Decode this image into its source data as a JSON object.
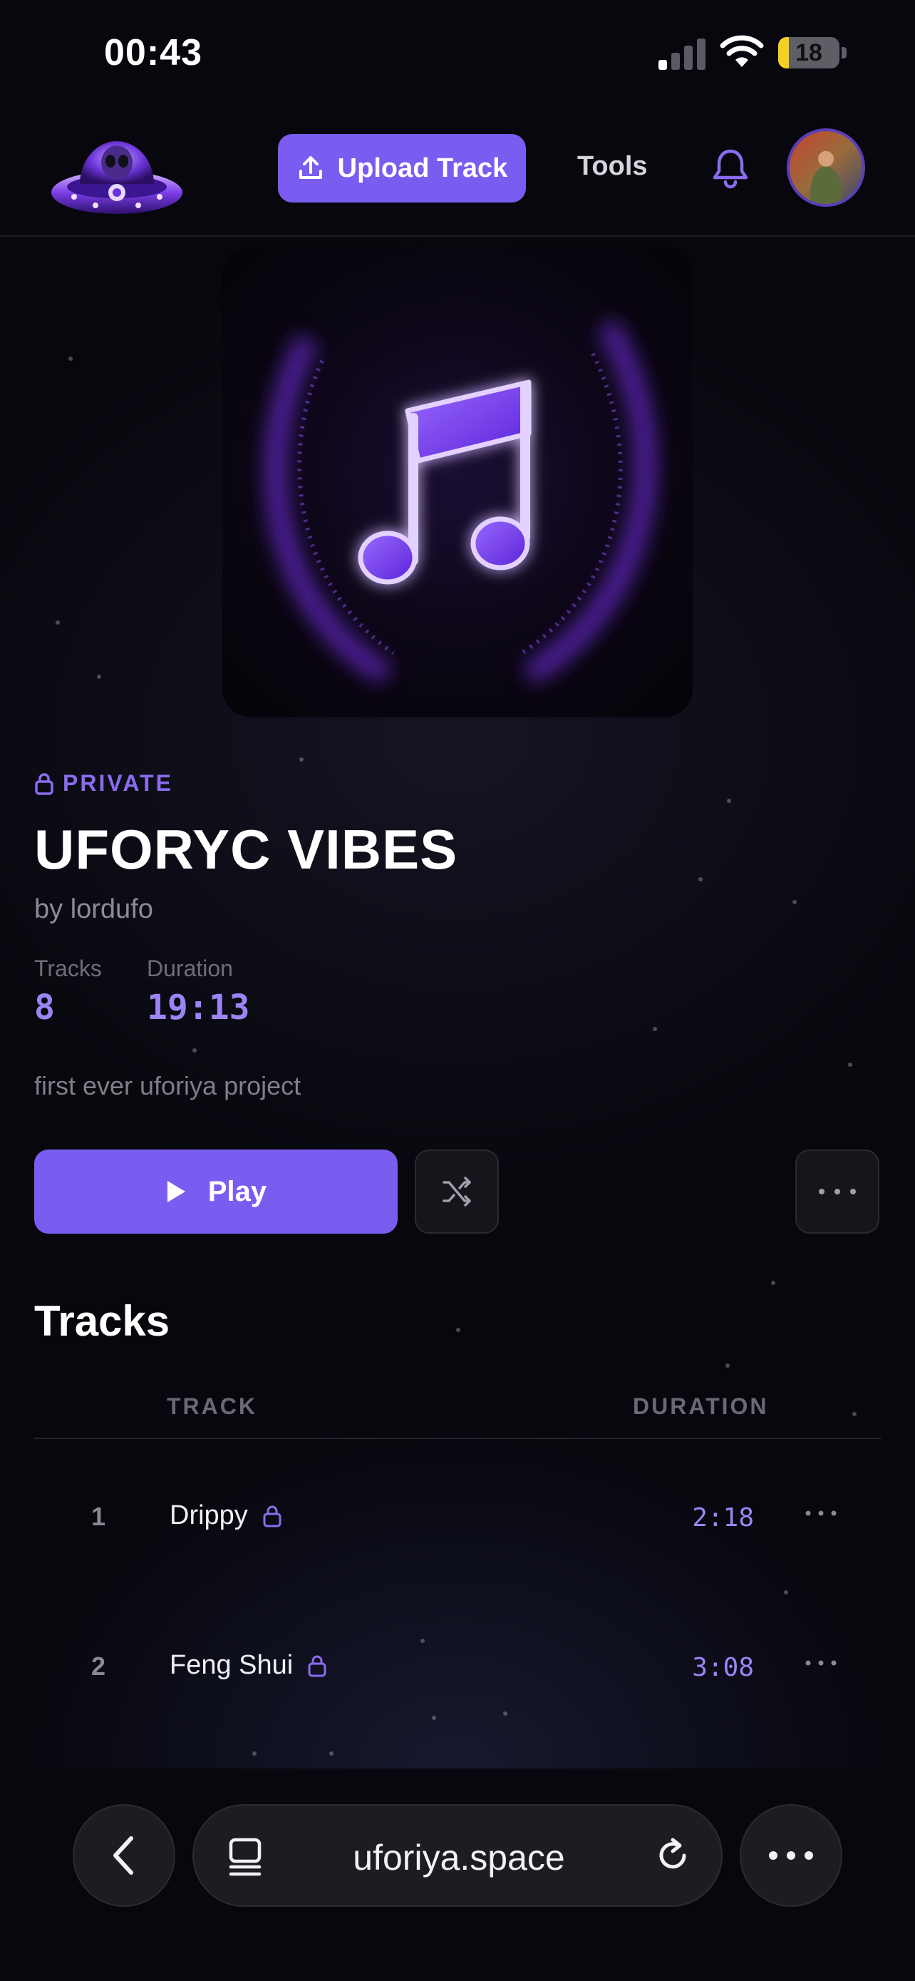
{
  "status_bar": {
    "time": "00:43",
    "battery_percent": "18",
    "battery_level": 0.18,
    "battery_color": "#f5d020"
  },
  "header": {
    "logo_icon": "ufo-alien-logo-icon",
    "upload_label": "Upload Track",
    "upload_icon": "upload-icon",
    "tools_label": "Tools",
    "notifications_icon": "bell-icon",
    "avatar_icon": "user-avatar",
    "accent_color": "#7b5cf0"
  },
  "album": {
    "cover_icon": "music-note-icon",
    "visibility": "PRIVATE",
    "visibility_icon": "lock-icon",
    "title": "UFORYC VIBES",
    "byline": "by lordufo",
    "stats": {
      "tracks_label": "Tracks",
      "tracks_value": "8",
      "duration_label": "Duration",
      "duration_value": "19:13"
    },
    "description": "first ever uforiya project"
  },
  "actions": {
    "play_label": "Play",
    "play_icon": "play-icon",
    "shuffle_icon": "shuffle-icon",
    "more_icon": "more-horizontal-icon"
  },
  "tracks": {
    "heading": "Tracks",
    "columns": {
      "track": "TRACK",
      "duration": "DURATION"
    },
    "rows": [
      {
        "number": "1",
        "title": "Drippy",
        "duration": "2:18",
        "locked": true
      },
      {
        "number": "2",
        "title": "Feng Shui",
        "duration": "3:08",
        "locked": true
      }
    ]
  },
  "browser": {
    "back_icon": "chevron-left-icon",
    "tabs_icon": "tabs-icon",
    "url": "uforiya.space",
    "reload_icon": "reload-icon",
    "menu_icon": "more-horizontal-icon"
  }
}
